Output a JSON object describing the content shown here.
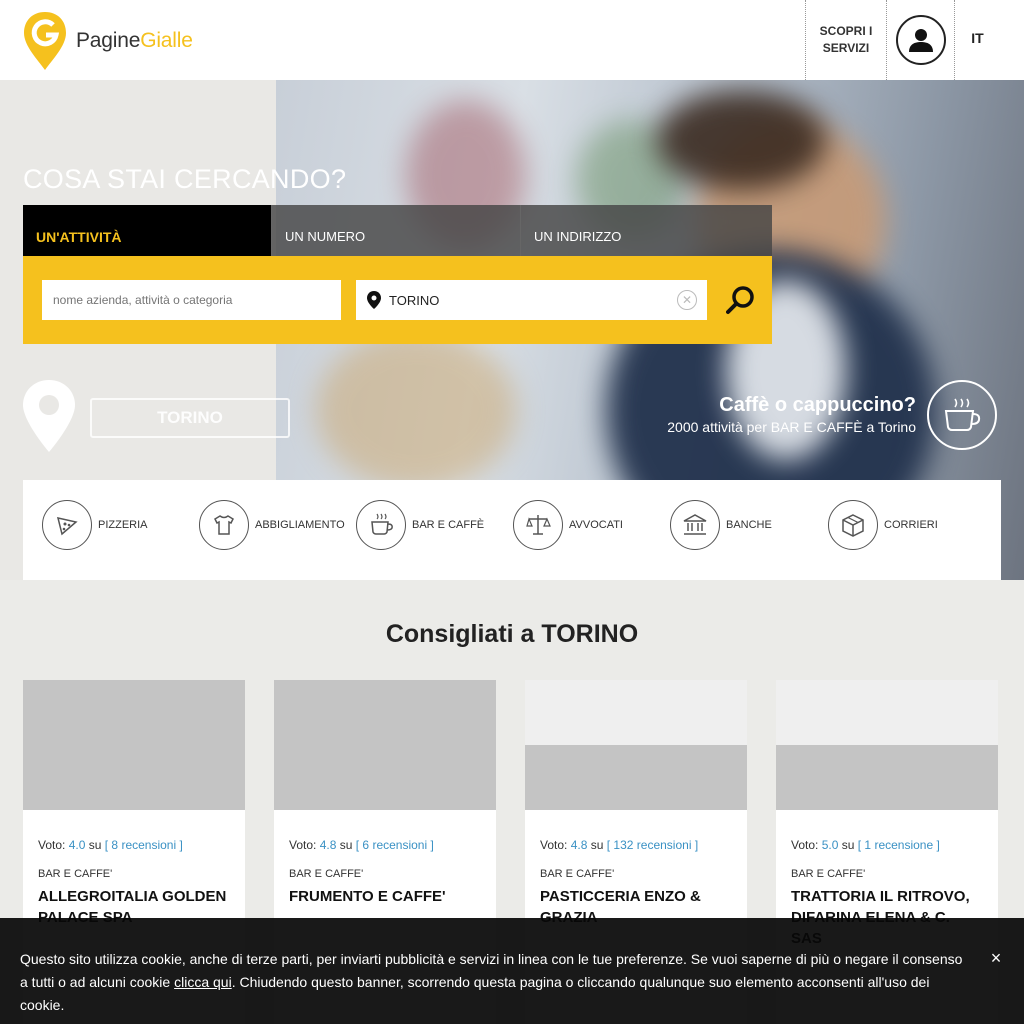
{
  "header": {
    "logo": {
      "part1": "Pagine",
      "part2": "Gialle"
    },
    "scopri_label": "SCOPRI I SERVIZI",
    "lang": "IT"
  },
  "hero": {
    "title": "COSA STAI CERCANDO?",
    "tabs": [
      {
        "label": "UN'ATTIVITÀ",
        "active": true
      },
      {
        "label": "UN NUMERO",
        "active": false
      },
      {
        "label": "UN INDIRIZZO",
        "active": false
      }
    ],
    "search": {
      "what_placeholder": "nome azienda, attività o categoria",
      "where_value": "TORINO"
    },
    "city_button": "TORINO",
    "promo": {
      "title": "Caffè o cappuccino?",
      "subtitle": "2000 attività per BAR E CAFFÈ a Torino"
    }
  },
  "categories": [
    {
      "label": "PIZZERIA",
      "icon": "pizza-icon"
    },
    {
      "label": "ABBIGLIAMENTO",
      "icon": "tshirt-icon"
    },
    {
      "label": "BAR E CAFFÈ",
      "icon": "coffee-cup-icon"
    },
    {
      "label": "AVVOCATI",
      "icon": "scales-icon"
    },
    {
      "label": "BANCHE",
      "icon": "bank-icon"
    },
    {
      "label": "CORRIERI",
      "icon": "package-icon"
    }
  ],
  "recommended": {
    "title_prefix": "Consigliati a",
    "title_city": "TORINO",
    "cards": [
      {
        "vote_label": "Voto:",
        "score": "4.0",
        "su": "su",
        "reviews": "[ 8 recensioni ]",
        "category": "BAR E CAFFE'",
        "name": "ALLEGROITALIA GOLDEN PALACE SPA"
      },
      {
        "vote_label": "Voto:",
        "score": "4.8",
        "su": "su",
        "reviews": "[ 6 recensioni ]",
        "category": "BAR E CAFFE'",
        "name": "FRUMENTO E CAFFE'"
      },
      {
        "vote_label": "Voto:",
        "score": "4.8",
        "su": "su",
        "reviews": "[ 132 recensioni ]",
        "category": "BAR E CAFFE'",
        "name": "PASTICCERIA ENZO & GRAZIA"
      },
      {
        "vote_label": "Voto:",
        "score": "5.0",
        "su": "su",
        "reviews": "[ 1 recensione ]",
        "category": "BAR E CAFFE'",
        "name": "TRATTORIA IL RITROVO, DIFARINA ELENA & C. SAS"
      }
    ]
  },
  "cookie": {
    "text_before": "Questo sito utilizza cookie, anche di terze parti, per inviarti pubblicità e servizi in linea con le tue preferenze. Se vuoi saperne di più o negare il consenso a tutti o ad alcuni cookie ",
    "link": "clicca qui",
    "text_after": ". Chiudendo questo banner, scorrendo questa pagina o cliccando qualunque suo elemento acconsenti all'uso dei cookie.",
    "close": "×"
  },
  "colors": {
    "brand_yellow": "#f5c11e",
    "link_blue": "#3a91c4",
    "dark": "#000000"
  }
}
